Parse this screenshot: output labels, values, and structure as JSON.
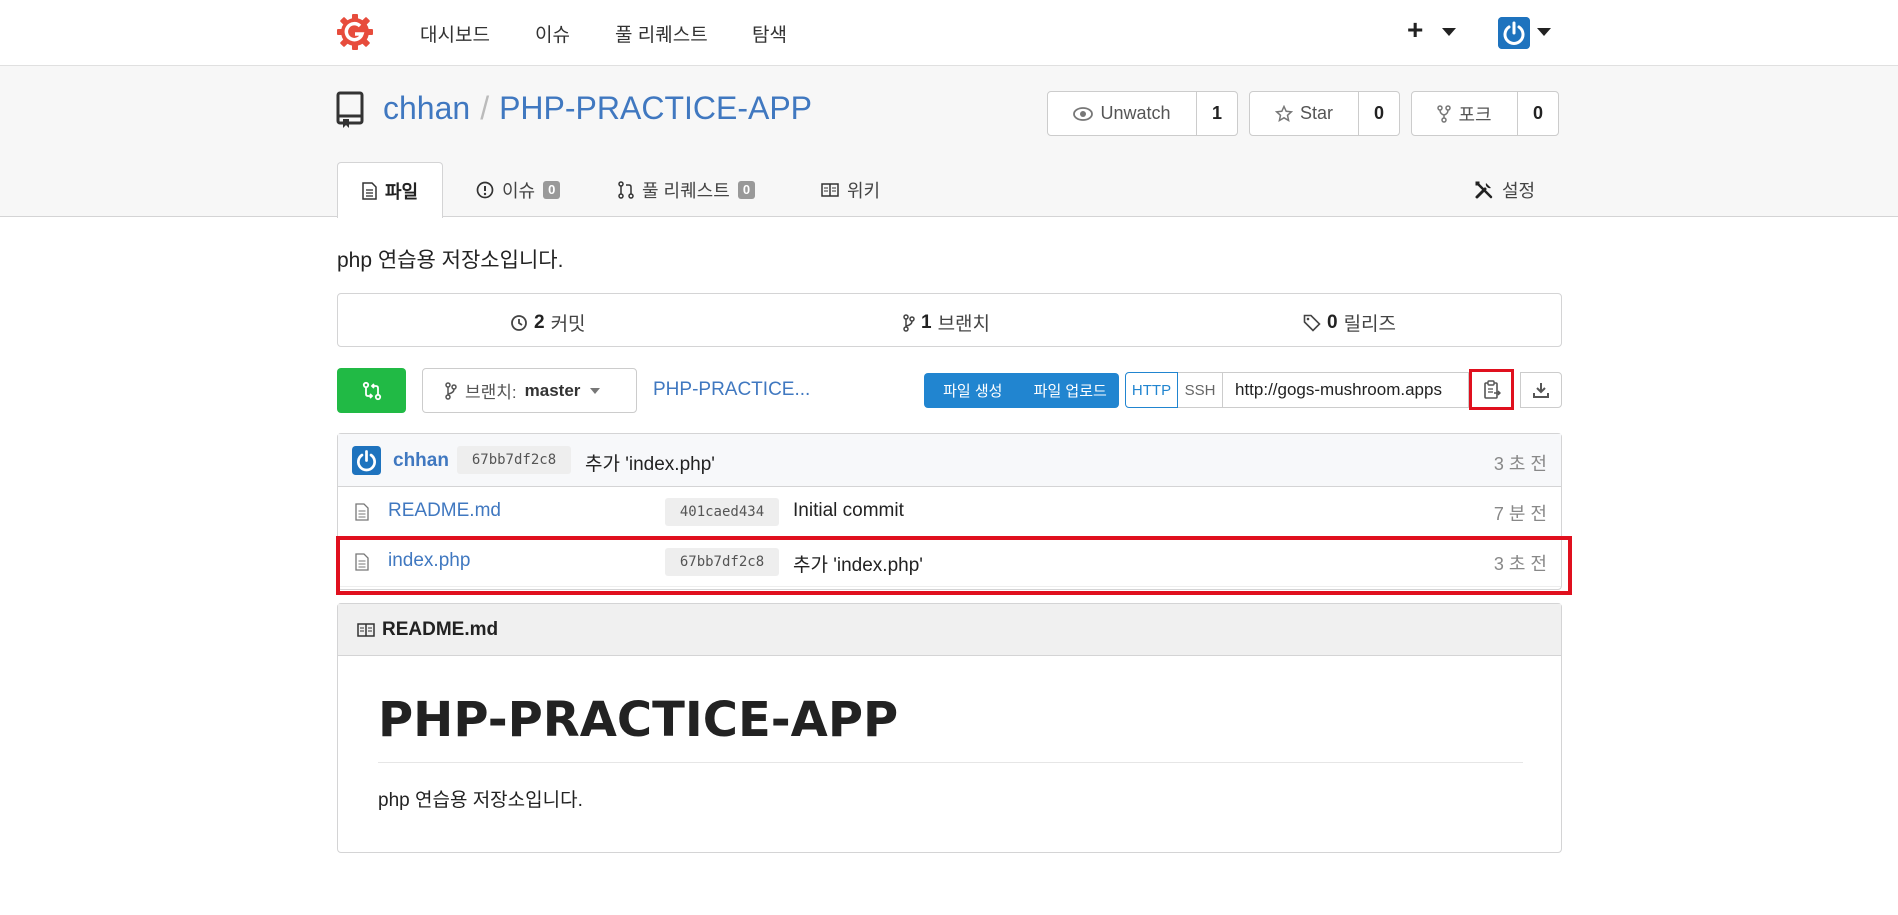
{
  "nav": {
    "items": [
      "대시보드",
      "이슈",
      "풀 리퀘스트",
      "탐색"
    ],
    "plus": "+",
    "brand_color": "#e74c3c",
    "accent_color": "#1e73be"
  },
  "repo": {
    "owner": "chhan",
    "separator": "/",
    "name": "PHP-PRACTICE-APP",
    "watch": {
      "label": "Unwatch",
      "count": "1"
    },
    "star": {
      "label": "Star",
      "count": "0"
    },
    "fork": {
      "label": "포크",
      "count": "0"
    },
    "tabs": {
      "files": "파일",
      "issues": "이슈",
      "issues_count": "0",
      "pulls": "풀 리퀘스트",
      "pulls_count": "0",
      "wiki": "위키",
      "settings": "설정"
    },
    "description": "php 연습용 저장소입니다."
  },
  "stats": {
    "commits_count": "2",
    "commits_label": "커밋",
    "branches_count": "1",
    "branches_label": "브랜치",
    "releases_count": "0",
    "releases_label": "릴리즈"
  },
  "toolbar": {
    "branch_prefix": "브랜치:",
    "branch_name": "master",
    "breadcrumb": "PHP-PRACTICE...",
    "new_file": "파일 생성",
    "upload_file": "파일 업로드",
    "http": "HTTP",
    "ssh": "SSH",
    "clone_url": "http://gogs-mushroom.apps"
  },
  "latest_commit": {
    "author": "chhan",
    "sha": "67bb7df2c8",
    "message": "추가 'index.php'",
    "time": "3 초 전"
  },
  "files": [
    {
      "name": "README.md",
      "sha": "401caed434",
      "message": "Initial commit",
      "time": "7 분 전"
    },
    {
      "name": "index.php",
      "sha": "67bb7df2c8",
      "message": "추가 'index.php'",
      "time": "3 초 전"
    }
  ],
  "readme": {
    "filename": "README.md",
    "heading": "PHP-PRACTICE-APP",
    "body": "php 연습용 저장소입니다."
  }
}
